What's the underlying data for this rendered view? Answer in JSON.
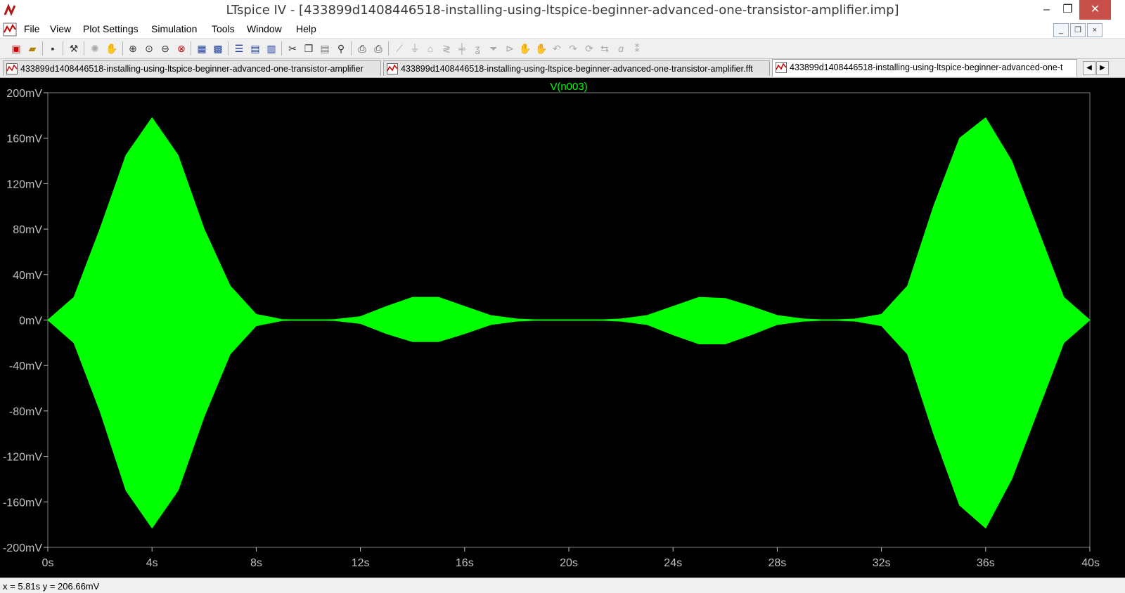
{
  "window": {
    "title": "LTspice IV - [433899d1408446518-installing-using-ltspice-beginner-advanced-one-transistor-amplifier.imp]",
    "min_label": "–",
    "max_label": "❐",
    "close_label": "✕"
  },
  "menu": {
    "items": [
      "File",
      "View",
      "Plot Settings",
      "Simulation",
      "Tools",
      "Window",
      "Help"
    ],
    "mdi": {
      "min": "_",
      "restore": "❐",
      "close": "×"
    }
  },
  "toolbar": {
    "icons": [
      "new-schematic-icon",
      "open-icon",
      "save-icon",
      "control-panel-icon",
      "run-icon",
      "pan-hand-icon",
      "zoom-area-icon",
      "zoom-in-icon",
      "zoom-out-icon",
      "zoom-fit-icon",
      "autorange-icon",
      "grid-icon",
      "tile-horizontal-icon",
      "tile-vertical-icon",
      "cascade-icon",
      "cut-icon",
      "copy-icon",
      "paste-icon",
      "find-icon",
      "print-preview-icon",
      "print-icon",
      "draw-wire-icon",
      "ground-icon",
      "label-net-icon",
      "resistor-icon",
      "capacitor-icon",
      "inductor-icon",
      "diode-icon",
      "component-icon",
      "move-icon",
      "drag-icon",
      "undo-icon",
      "redo-icon",
      "rotate-icon",
      "mirror-icon",
      "text-icon",
      "spice-directive-icon"
    ]
  },
  "tabs": [
    {
      "label": "433899d1408446518-installing-using-ltspice-beginner-advanced-one-transistor-amplifier",
      "active": false
    },
    {
      "label": "433899d1408446518-installing-using-ltspice-beginner-advanced-one-transistor-amplifier.fft",
      "active": false
    },
    {
      "label": "433899d1408446518-installing-using-ltspice-beginner-advanced-one-t",
      "active": true
    }
  ],
  "tab_scroll": {
    "left": "◀",
    "right": "▶"
  },
  "status": {
    "text": "x = 5.81s    y = 206.66mV"
  },
  "colors": {
    "trace": "#00ff00",
    "background": "#000000",
    "axis_text": "#c0c0c0",
    "accent": "#c7504a"
  },
  "chart_data": {
    "type": "area",
    "title": "V(n003)",
    "xlabel": "",
    "ylabel": "",
    "x_ticks": [
      "0s",
      "4s",
      "8s",
      "12s",
      "16s",
      "20s",
      "24s",
      "28s",
      "32s",
      "36s",
      "40s"
    ],
    "y_ticks": [
      "200mV",
      "160mV",
      "120mV",
      "80mV",
      "40mV",
      "0mV",
      "-40mV",
      "-80mV",
      "-120mV",
      "-160mV",
      "-200mV"
    ],
    "xlim": [
      0,
      40
    ],
    "ylim": [
      -200,
      200
    ],
    "grid": false,
    "series": [
      {
        "name": "V(n003)",
        "upper_envelope": [
          [
            0,
            0
          ],
          [
            1,
            20
          ],
          [
            2,
            80
          ],
          [
            3,
            145
          ],
          [
            4,
            178
          ],
          [
            5,
            145
          ],
          [
            6,
            80
          ],
          [
            7,
            30
          ],
          [
            8,
            5
          ],
          [
            9,
            0.5
          ],
          [
            10,
            0
          ],
          [
            11,
            0.5
          ],
          [
            12,
            3
          ],
          [
            13,
            12
          ],
          [
            14,
            20
          ],
          [
            15,
            20
          ],
          [
            16,
            12
          ],
          [
            17,
            4
          ],
          [
            18,
            1
          ],
          [
            19,
            0
          ],
          [
            20,
            0
          ],
          [
            21,
            0
          ],
          [
            22,
            1
          ],
          [
            23,
            4
          ],
          [
            24,
            12
          ],
          [
            25,
            20
          ],
          [
            26,
            19
          ],
          [
            27,
            12
          ],
          [
            28,
            4
          ],
          [
            29,
            1
          ],
          [
            30,
            0
          ],
          [
            31,
            1
          ],
          [
            32,
            5
          ],
          [
            33,
            30
          ],
          [
            34,
            100
          ],
          [
            35,
            160
          ],
          [
            36,
            178
          ],
          [
            37,
            140
          ],
          [
            38,
            80
          ],
          [
            39,
            20
          ],
          [
            40,
            0
          ]
        ],
        "lower_envelope": [
          [
            0,
            0
          ],
          [
            1,
            -20
          ],
          [
            2,
            -80
          ],
          [
            3,
            -150
          ],
          [
            4,
            -183
          ],
          [
            5,
            -150
          ],
          [
            6,
            -85
          ],
          [
            7,
            -30
          ],
          [
            8,
            -5
          ],
          [
            9,
            -0.5
          ],
          [
            10,
            0
          ],
          [
            11,
            -0.5
          ],
          [
            12,
            -3
          ],
          [
            13,
            -12
          ],
          [
            14,
            -19
          ],
          [
            15,
            -19
          ],
          [
            16,
            -12
          ],
          [
            17,
            -4
          ],
          [
            18,
            -1
          ],
          [
            19,
            0
          ],
          [
            20,
            0
          ],
          [
            21,
            0
          ],
          [
            22,
            -1
          ],
          [
            23,
            -4
          ],
          [
            24,
            -13
          ],
          [
            25,
            -21
          ],
          [
            26,
            -21
          ],
          [
            27,
            -13
          ],
          [
            28,
            -4
          ],
          [
            29,
            -1
          ],
          [
            30,
            0
          ],
          [
            31,
            -1
          ],
          [
            32,
            -5
          ],
          [
            33,
            -30
          ],
          [
            34,
            -100
          ],
          [
            35,
            -163
          ],
          [
            36,
            -183
          ],
          [
            37,
            -140
          ],
          [
            38,
            -80
          ],
          [
            39,
            -20
          ],
          [
            40,
            0
          ]
        ]
      }
    ]
  }
}
